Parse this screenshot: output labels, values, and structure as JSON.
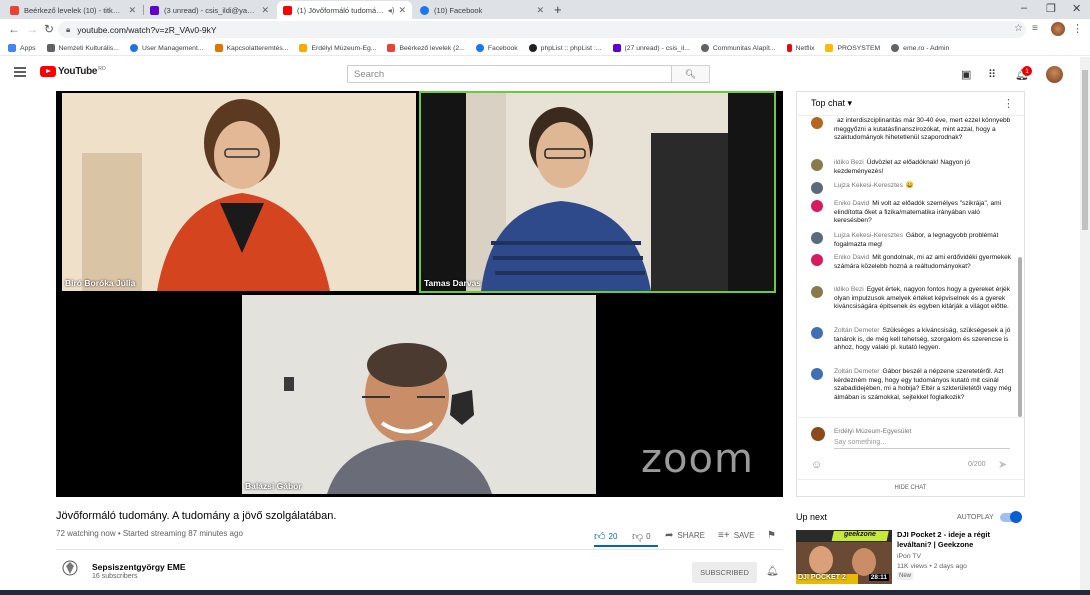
{
  "browser": {
    "tabs": [
      {
        "title": "Beérkező levelek (10) - titkarsag@",
        "fav_color": "#ea4335",
        "active": false
      },
      {
        "title": "(3 unread) - csis_ildi@yahoo.com",
        "fav_color": "#6001d2",
        "active": false
      },
      {
        "title": "(1) Jövőformáló tudomány. A",
        "fav_color": "#ff0000",
        "active": true
      },
      {
        "title": "(10) Facebook",
        "fav_color": "#1877f2",
        "active": false
      }
    ],
    "url": "youtube.com/watch?v=zR_VAv0-9kY",
    "bookmarks": [
      {
        "label": "Apps",
        "color": "#4285f4"
      },
      {
        "label": "Nemzeti Kulturális...",
        "color": "#5f6368"
      },
      {
        "label": "User Management...",
        "color": "#1a73e8"
      },
      {
        "label": "Kapcsolatteremtés...",
        "color": "#e37400"
      },
      {
        "label": "Erdélyi Múzeum-Eg...",
        "color": "#f9ab00"
      },
      {
        "label": "Beérkező levelek (2...",
        "color": "#ea4335"
      },
      {
        "label": "Facebook",
        "color": "#1877f2"
      },
      {
        "label": "phpList :: phpList :...",
        "color": "#202124"
      },
      {
        "label": "(27 unread) - csis_il...",
        "color": "#6001d2"
      },
      {
        "label": "Communitas Alapít...",
        "color": "#5f6368"
      },
      {
        "label": "Netflix",
        "color": "#e50914"
      },
      {
        "label": "PROSYSTEM",
        "color": "#fbbc04"
      },
      {
        "label": "eme.ro - Admin",
        "color": "#5f6368"
      }
    ]
  },
  "youtube": {
    "logo_text": "YouTube",
    "region": "RO",
    "search_placeholder": "Search",
    "notification_count": "1"
  },
  "video": {
    "participants": [
      {
        "name": "Bíró Boróka Júlia"
      },
      {
        "name": "Tamas Darvas"
      },
      {
        "name": "Balázsi Gábor"
      }
    ],
    "watermark": "zoom",
    "title": "Jövőformáló tudomány. A tudomány a jövő szolgálatában.",
    "meta": "72 watching now • Started streaming 87 minutes ago",
    "likes": "20",
    "dislikes": "0",
    "like_ratio": 1.0,
    "share_label": "SHARE",
    "save_label": "SAVE"
  },
  "channel": {
    "name": "Sepsiszentgyörgy EME",
    "subscribers": "16 subscribers",
    "subscribe_label": "SUBSCRIBED"
  },
  "chat": {
    "header": "Top chat",
    "messages": [
      {
        "author": "",
        "text": "az interdiszciplinaritás már 30-40 éve, mert ezzel könnyebb meggyőzni a kutatásfinanszírozókat, mint azzal, hogy a szaktudományok hihetetlenül szaporodnak?",
        "color": "#b5651d"
      },
      {
        "author": "ildiko Bezi",
        "text": "Üdvözlet az előadóknak! Nagyon jó kezdeményezés!",
        "color": "#8a7a4a"
      },
      {
        "author": "Lujza Kekesi-Keresztes",
        "text": "😄",
        "color": "#5a6b7c"
      },
      {
        "author": "Eniko David",
        "text": "Mi volt az előadók személyes \"szikrája\", ami elindította őket a fizika/matematika irányában való keresésben?",
        "color": "#d81b60"
      },
      {
        "author": "Lujza Kekesi-Keresztes",
        "text": "Gábor, a legnagyobb problémát fogalmazta meg!",
        "color": "#5a6b7c"
      },
      {
        "author": "Eniko David",
        "text": "Mit gondolnak, mi az ami erdővidéki gyermekek számára közelebb hozná a reáltudományokat?",
        "color": "#d81b60"
      },
      {
        "author": "ildiko Bezi",
        "text": "Egyet értek, nagyon fontos hogy a gyereket érjék olyan impulzusok amelyek értéket képviselnek és a gyerek kiváncsiságára épitsenek és egyben kitárják a világot előtte.",
        "color": "#8a7a4a"
      },
      {
        "author": "Zoltán Demeter",
        "text": "Szükséges a kiváncsiság, szükségesek a jó tanárok is, de még kell tehetség, szorgalom és szerencse is ahhoz, hogy valaki pl. kutató legyen.",
        "color": "#3f6fb5"
      },
      {
        "author": "Zoltán Demeter",
        "text": "Gábor beszél a népzene szeretetéről. Azt kérdezném meg, hogy egy tudományos kutató mit csinál szabadidejében, mi a hobija? Eltér a szkterületétől vagy még álmában is számokkal, sejtekkel foglalkozik?",
        "color": "#3f6fb5"
      }
    ],
    "current_user": "Erdélyi Múzeum-Egyesület",
    "input_placeholder": "Say something...",
    "char_count": "0/200",
    "hide_label": "HIDE CHAT"
  },
  "upnext": {
    "label": "Up next",
    "autoplay_label": "AUTOPLAY",
    "title": "DJI Pocket 2 - ideje a régit leváltani? | Geekzone",
    "channel": "iPon TV",
    "views": "11K views • 2 days ago",
    "badge": "New",
    "duration": "28:11",
    "thumb_brand": "geekzone",
    "thumb_caption": "DJI POCKET 2"
  }
}
